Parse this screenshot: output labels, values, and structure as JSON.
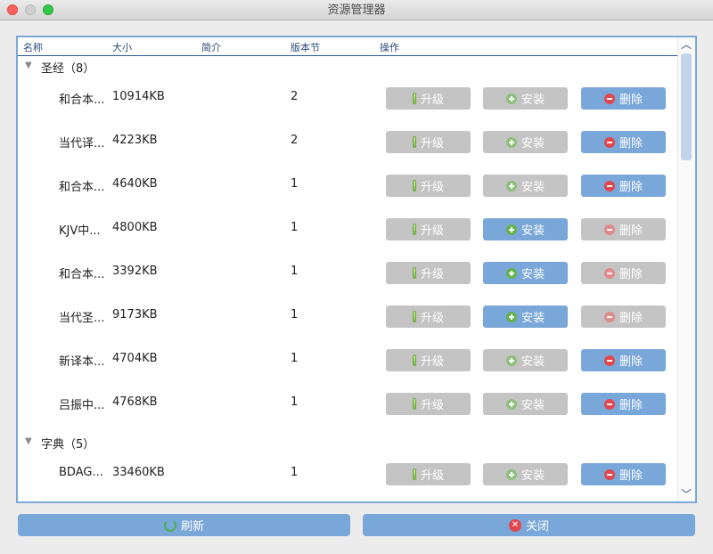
{
  "window": {
    "title": "资源管理器"
  },
  "columns": {
    "name": "名称",
    "size": "大小",
    "desc": "简介",
    "version": "版本节",
    "action": "操作"
  },
  "buttons": {
    "upgrade": "升级",
    "install": "安装",
    "delete": "删除"
  },
  "groups": [
    {
      "label": "圣经（8）",
      "items": [
        {
          "name": "和合本...",
          "size": "10914KB",
          "version": "2",
          "upgrade": false,
          "install": false,
          "delete": true
        },
        {
          "name": "当代译...",
          "size": "4223KB",
          "version": "2",
          "upgrade": false,
          "install": false,
          "delete": true
        },
        {
          "name": "和合本...",
          "size": "4640KB",
          "version": "1",
          "upgrade": false,
          "install": false,
          "delete": true
        },
        {
          "name": "KJV中...",
          "size": "4800KB",
          "version": "1",
          "upgrade": false,
          "install": true,
          "delete": false
        },
        {
          "name": "和合本...",
          "size": "3392KB",
          "version": "1",
          "upgrade": false,
          "install": true,
          "delete": false
        },
        {
          "name": "当代圣...",
          "size": "9173KB",
          "version": "1",
          "upgrade": false,
          "install": true,
          "delete": false
        },
        {
          "name": "新译本...",
          "size": "4704KB",
          "version": "1",
          "upgrade": false,
          "install": false,
          "delete": true
        },
        {
          "name": "吕振中...",
          "size": "4768KB",
          "version": "1",
          "upgrade": false,
          "install": false,
          "delete": true
        }
      ]
    },
    {
      "label": "字典（5）",
      "items": [
        {
          "name": "BDAG...",
          "size": "33460KB",
          "version": "1",
          "upgrade": false,
          "install": false,
          "delete": true
        },
        {
          "name": "",
          "size": "",
          "version": "",
          "upgrade": false,
          "install": false,
          "delete": true
        }
      ]
    }
  ],
  "footer": {
    "refresh": "刷新",
    "close": "关闭"
  },
  "colors": {
    "accent": "#7aa7d9",
    "disabled": "#c4c4c4",
    "border": "#7ba7d9"
  }
}
